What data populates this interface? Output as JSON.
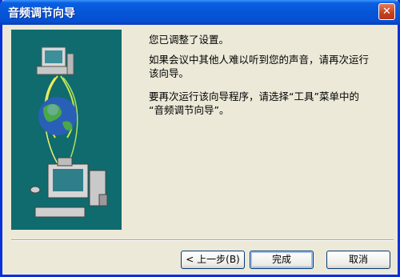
{
  "window": {
    "title": "音频调节向导",
    "close_glyph": "✕"
  },
  "content": {
    "para1": "您已调整了设置。",
    "para2": "如果会议中其他人难以听到您的声音，请再次运行\n该向导。",
    "para3": "要再次运行该向导程序，请选择“工具”菜单中的\n“音频调节向导”。"
  },
  "buttons": {
    "back": "< 上一步(B)",
    "finish": "完成",
    "cancel": "取消"
  },
  "colors": {
    "titlebar": "#0655d8",
    "panel": "#0f6b6d",
    "dialog_bg": "#ece9d8"
  }
}
